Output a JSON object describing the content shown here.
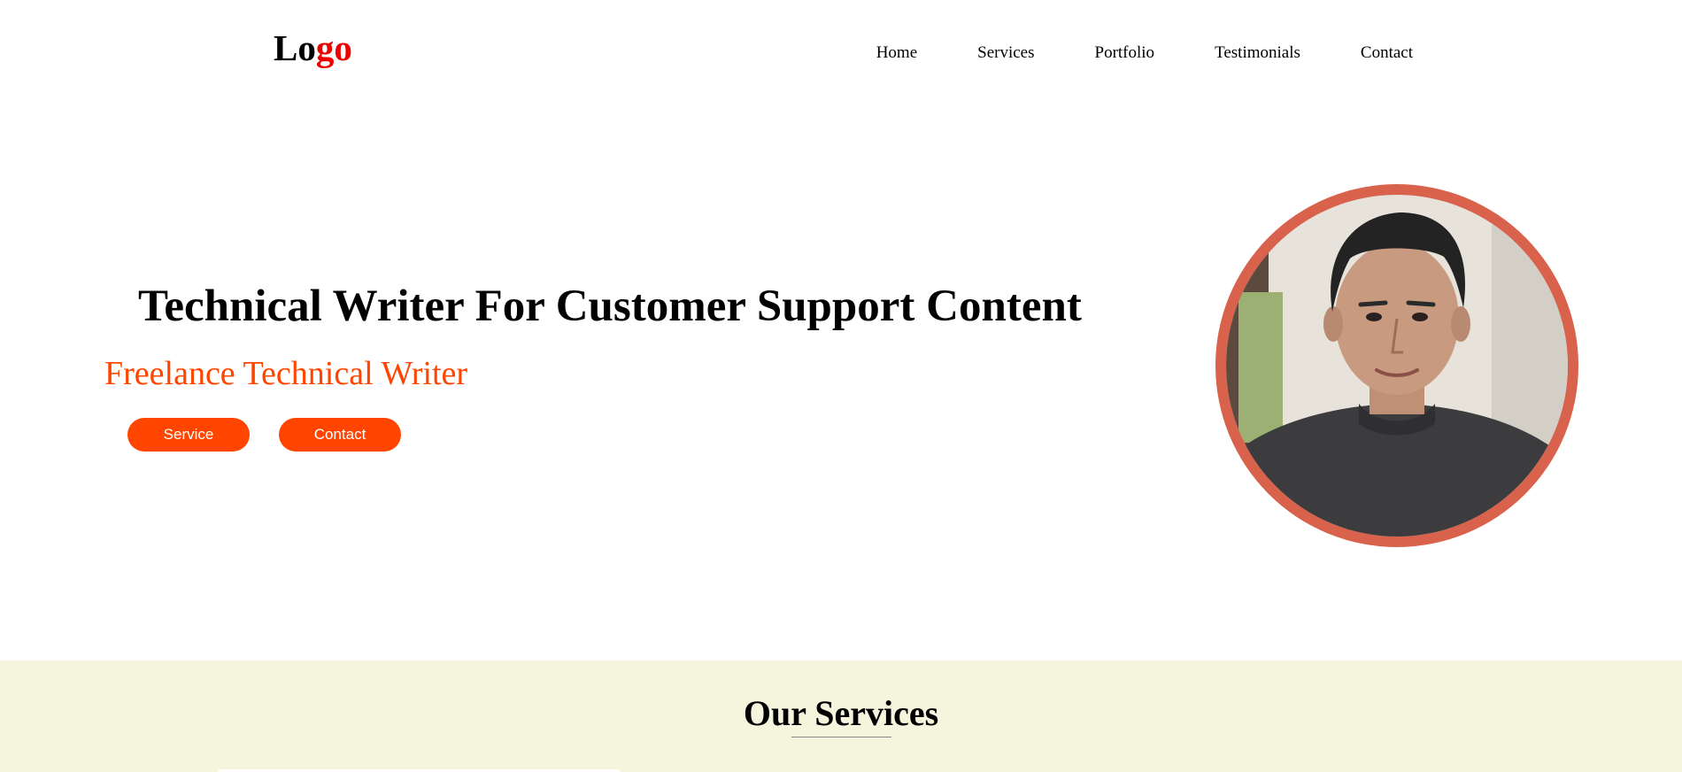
{
  "colors": {
    "accent": "#ff4500",
    "logo_accent": "#ee0000",
    "portrait_ring": "#d9624c",
    "services_background": "#f5f4dc"
  },
  "header": {
    "logo_part1": "Lo",
    "logo_part2": "go",
    "nav": [
      "Home",
      "Services",
      "Portfolio",
      "Testimonials",
      "Contact"
    ]
  },
  "hero": {
    "title": "Technical Writer For Customer Support Content",
    "subtitle": "Freelance Technical Writer",
    "buttons": {
      "service": "Service",
      "contact": "Contact"
    }
  },
  "services": {
    "title": "Our Services"
  }
}
